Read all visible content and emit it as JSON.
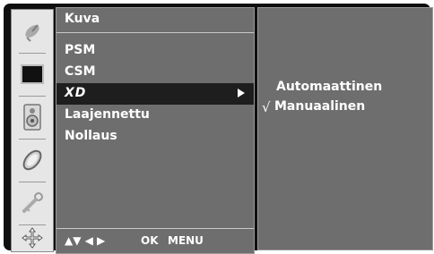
{
  "menu": {
    "title": "Kuva",
    "items": [
      {
        "label": "PSM"
      },
      {
        "label": "CSM"
      },
      {
        "label": "XD"
      },
      {
        "label": "Laajennettu"
      },
      {
        "label": "Nollaus"
      }
    ],
    "selected_index": 2
  },
  "navigation_hint": {
    "arrows": "▲▼  ◀ ▶",
    "ok": "OK",
    "menu": "MENU"
  },
  "submenu": {
    "options": [
      {
        "label": "Automaattinen",
        "checked": false
      },
      {
        "label": "Manuaalinen",
        "checked": true
      }
    ],
    "check_mark": "√"
  },
  "icons": [
    "satellite-dish-icon",
    "screen-icon",
    "speaker-icon",
    "clock-icon",
    "key-icon",
    "option-arrows-icon"
  ]
}
